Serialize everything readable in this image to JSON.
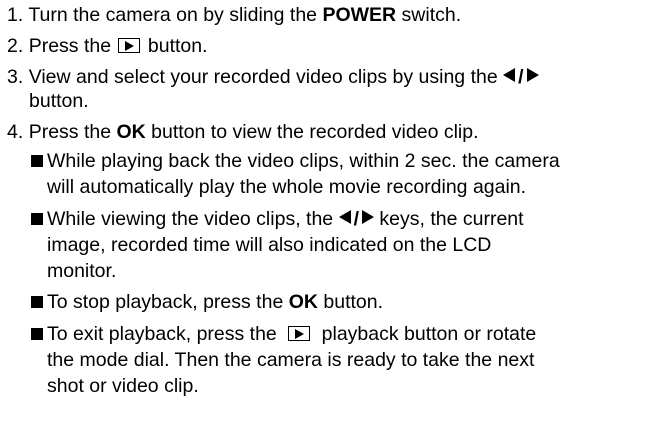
{
  "steps": {
    "s1": {
      "num": "1.",
      "pre": "Turn the camera on by sliding the",
      "bold": "POWER",
      "post": "switch."
    },
    "s2": {
      "num": "2.",
      "pre": "Press the",
      "post": "button."
    },
    "s3": {
      "num": "3.",
      "pre": "View and select your recorded video clips by using the",
      "cont": "button."
    },
    "s4": {
      "num": "4.",
      "pre": "Press the",
      "bold": "OK",
      "post": "button to view the recorded video clip."
    }
  },
  "bullets": {
    "b1": {
      "l1": "While playing back the video clips, within 2 sec. the camera",
      "l2": "will automatically play the whole movie recording again."
    },
    "b2": {
      "l1_pre": "While viewing the video clips, the",
      "l1_post": "keys, the current",
      "l2": "image, recorded time will also indicated on the LCD",
      "l3": "monitor."
    },
    "b3": {
      "pre": "To stop playback, press the",
      "bold": "OK",
      "post": "button."
    },
    "b4": {
      "l1_pre": "To exit playback, press the",
      "l1_post": "playback button or rotate",
      "l2": "the mode dial. Then the camera is ready to take the next",
      "l3": "shot or video clip."
    }
  },
  "symbols": {
    "slash": "/"
  },
  "icons": [
    "playback-icon",
    "left-arrow-icon",
    "right-arrow-icon",
    "bullet-square-icon"
  ]
}
